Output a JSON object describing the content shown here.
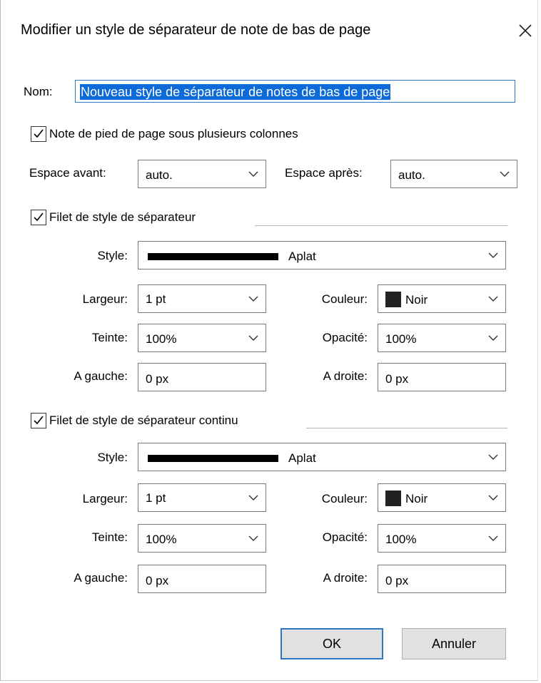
{
  "dialog": {
    "title": "Modifier un style de séparateur de note de bas de page",
    "close_glyph": "✕"
  },
  "name": {
    "label": "Nom:",
    "value": "Nouveau style de séparateur de notes de bas de page"
  },
  "multi_column": {
    "label": "Note de pied de page sous plusieurs colonnes",
    "checked": true
  },
  "spacing": {
    "before_label": "Espace avant:",
    "before_value": "auto.",
    "after_label": "Espace après:",
    "after_value": "auto."
  },
  "separator_rule": {
    "label": "Filet de style de séparateur",
    "checked": true,
    "style_label": "Style:",
    "style_value": "Aplat",
    "width_label": "Largeur:",
    "width_value": "1 pt",
    "color_label": "Couleur:",
    "color_value": "Noir",
    "color_hex": "#222222",
    "tint_label": "Teinte:",
    "tint_value": "100%",
    "opacity_label": "Opacité:",
    "opacity_value": "100%",
    "left_label": "A gauche:",
    "left_value": "0 px",
    "right_label": "A droite:",
    "right_value": "0 px"
  },
  "continuous_rule": {
    "label": "Filet de style de séparateur continu",
    "checked": true,
    "style_label": "Style:",
    "style_value": "Aplat",
    "width_label": "Largeur:",
    "width_value": "1 pt",
    "color_label": "Couleur:",
    "color_value": "Noir",
    "color_hex": "#222222",
    "tint_label": "Teinte:",
    "tint_value": "100%",
    "opacity_label": "Opacité:",
    "opacity_value": "100%",
    "left_label": "A gauche:",
    "left_value": "0 px",
    "right_label": "A droite:",
    "right_value": "0 px"
  },
  "buttons": {
    "ok": "OK",
    "cancel": "Annuler"
  },
  "colors": {
    "accent": "#2f76c6",
    "selection": "#0d6ad9",
    "button_face": "#e1e1e1"
  }
}
